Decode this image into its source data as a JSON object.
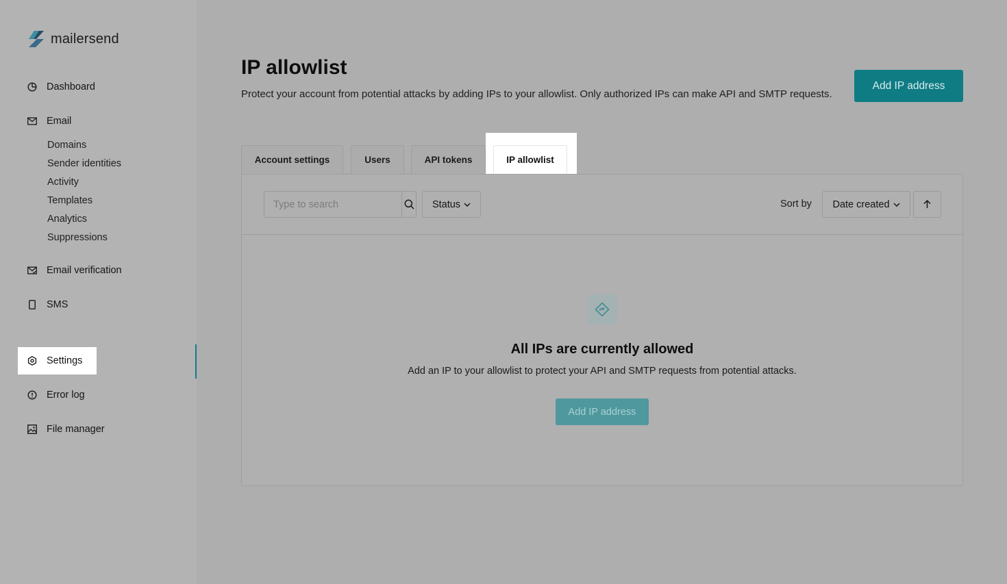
{
  "app": {
    "brand": "mailersend"
  },
  "sidebar": {
    "items": [
      {
        "label": "Dashboard",
        "icon": "dashboard-icon"
      },
      {
        "label": "Email",
        "icon": "email-icon"
      },
      {
        "label": "Email verification",
        "icon": "email-verification-icon"
      },
      {
        "label": "SMS",
        "icon": "sms-icon"
      },
      {
        "label": "Settings",
        "icon": "gear-icon",
        "active": true
      },
      {
        "label": "Error log",
        "icon": "error-icon"
      },
      {
        "label": "File manager",
        "icon": "file-manager-icon"
      }
    ],
    "email_sub": [
      "Domains",
      "Sender identities",
      "Activity",
      "Templates",
      "Analytics",
      "Suppressions"
    ]
  },
  "header": {
    "title": "IP allowlist",
    "description": "Protect your account from potential attacks by adding IPs to your allowlist. Only authorized IPs can make API and SMTP requests.",
    "add_button": "Add IP address"
  },
  "tabs": [
    {
      "label": "Account settings"
    },
    {
      "label": "Users"
    },
    {
      "label": "API tokens"
    },
    {
      "label": "IP allowlist",
      "active": true
    }
  ],
  "toolbar": {
    "search_placeholder": "Type to search",
    "status_label": "Status",
    "sort_label": "Sort by",
    "sort_value": "Date created"
  },
  "empty_state": {
    "title": "All IPs are currently allowed",
    "description": "Add an IP to your allowlist to protect your API and SMTP requests from potential attacks.",
    "button": "Add IP address"
  },
  "colors": {
    "accent": "#0f7c84",
    "highlight": "#ffffff"
  }
}
